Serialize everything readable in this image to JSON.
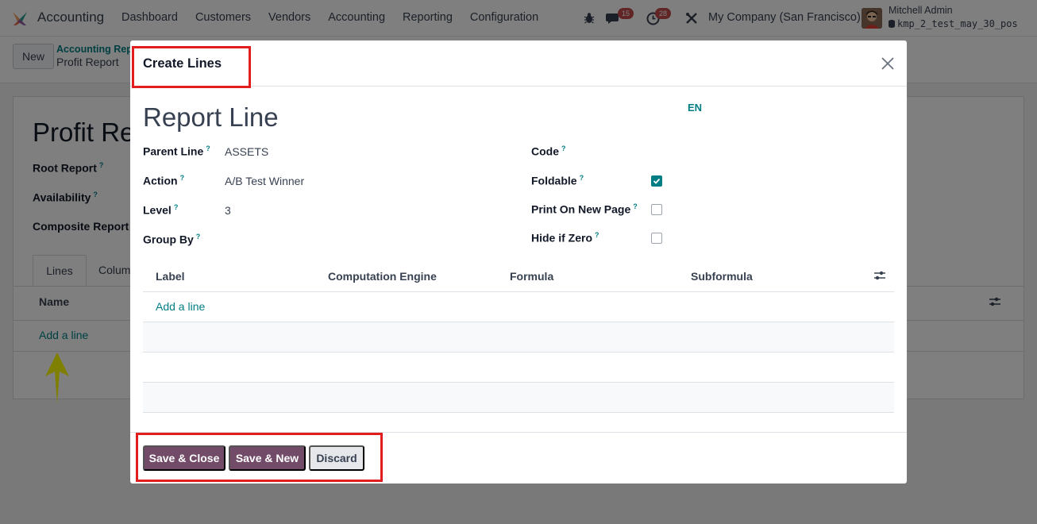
{
  "navbar": {
    "app_name": "Accounting",
    "menu": [
      "Dashboard",
      "Customers",
      "Vendors",
      "Accounting",
      "Reporting",
      "Configuration"
    ],
    "messages_count": "15",
    "activities_count": "28",
    "company": "My Company (San Francisco)",
    "user_name": "Mitchell Admin",
    "database": "kmp_2_test_may_30_pos"
  },
  "control_panel": {
    "new_label": "New",
    "breadcrumb_parent": "Accounting Rep",
    "breadcrumb_current": "Profit Report"
  },
  "sheet": {
    "title": "Profit Re",
    "fields": [
      "Root Report",
      "Availability",
      "Composite Report"
    ],
    "tabs": [
      "Lines",
      "Colum"
    ],
    "column_name": "Name",
    "add_line": "Add a line"
  },
  "dialog": {
    "title": "Create Lines",
    "record_title": "Report Line",
    "language": "EN",
    "left_fields": [
      {
        "label": "Parent Line",
        "value": "ASSETS"
      },
      {
        "label": "Action",
        "value": "A/B Test Winner"
      },
      {
        "label": "Level",
        "value": "3"
      },
      {
        "label": "Group By",
        "value": ""
      }
    ],
    "right_fields": [
      {
        "label": "Code",
        "checked": null
      },
      {
        "label": "Foldable",
        "checked": true
      },
      {
        "label": "Print On New Page",
        "checked": false
      },
      {
        "label": "Hide if Zero",
        "checked": false
      }
    ],
    "help_marker": "?",
    "grid_columns": [
      "Label",
      "Computation Engine",
      "Formula",
      "Subformula"
    ],
    "grid_add_line": "Add a line",
    "buttons": {
      "save_close": "Save & Close",
      "save_new": "Save & New",
      "discard": "Discard"
    }
  },
  "colors": {
    "brand_primary": "#714b67",
    "link_teal": "#017e84",
    "highlight_red": "#e11d1d",
    "arrow_yellow": "#ffff00"
  }
}
